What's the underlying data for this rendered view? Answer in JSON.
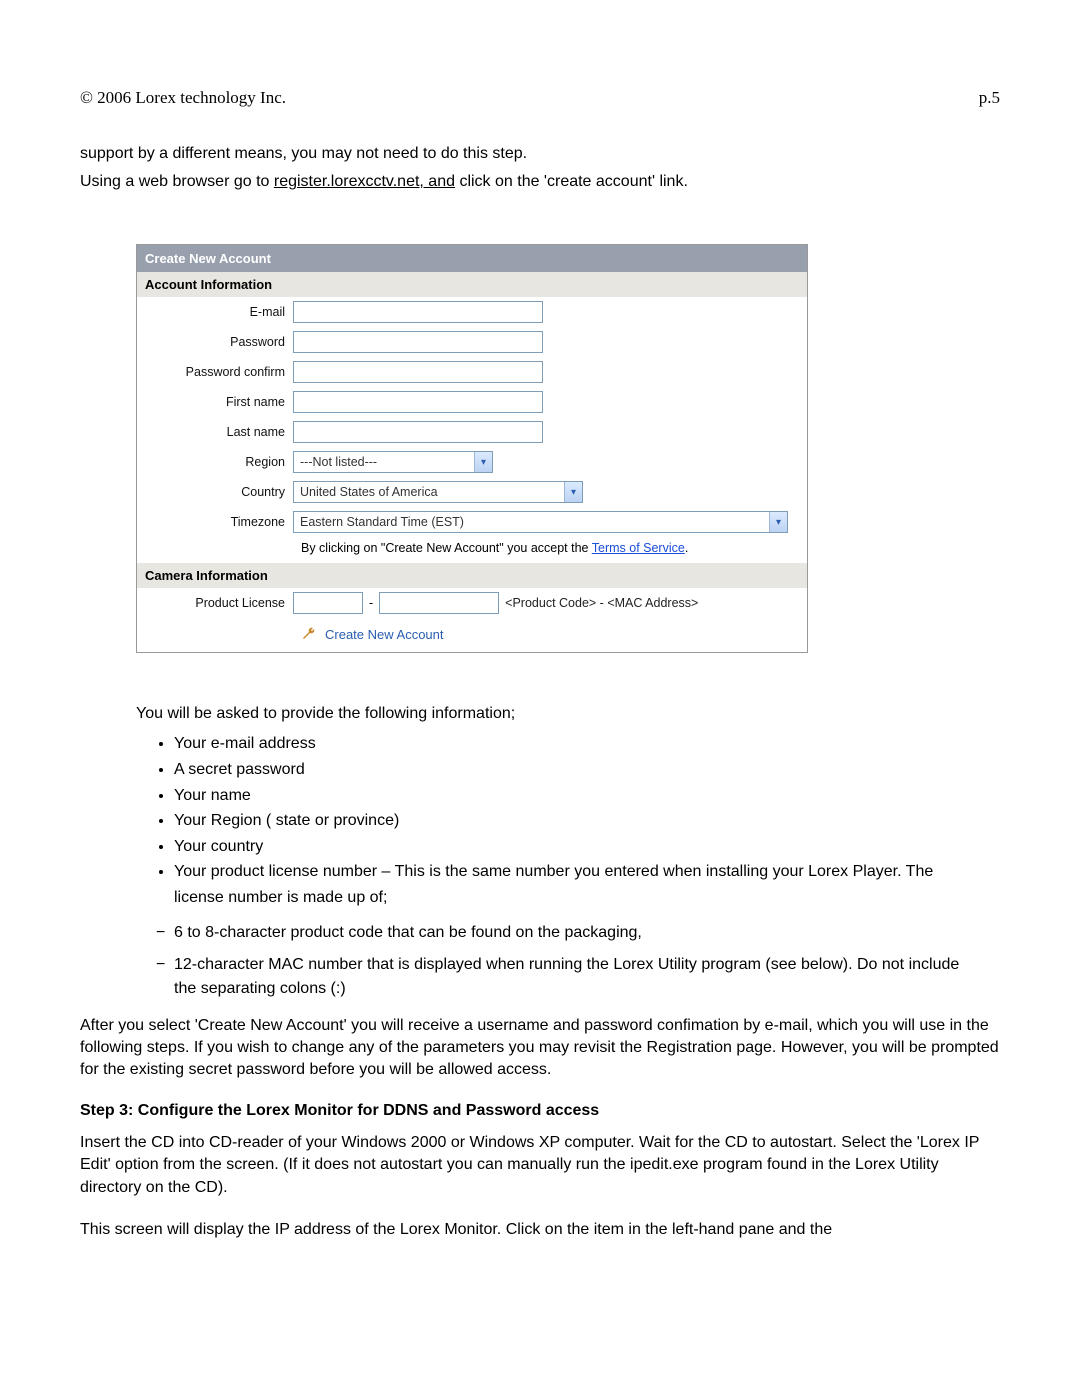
{
  "header": {
    "copyright": "© 2006 Lorex technology Inc.",
    "page": "p.5"
  },
  "intro": {
    "line1": "support by a different means, you may not need to do this step.",
    "line2a": "Using a web browser go to ",
    "link": "register.lorexcctv.net, and",
    "line2b": " click on the 'create account' link."
  },
  "form": {
    "title": "Create New Account",
    "section_account": "Account Information",
    "labels": {
      "email": "E-mail",
      "password": "Password",
      "password_confirm": "Password confirm",
      "first_name": "First name",
      "last_name": "Last name",
      "region": "Region",
      "country": "Country",
      "timezone": "Timezone",
      "product_license": "Product License"
    },
    "region_value": "---Not listed---",
    "country_value": "United States of America",
    "timezone_value": "Eastern Standard Time (EST)",
    "tos_pre": "By clicking on \"Create New Account\" you accept the ",
    "tos_link": "Terms of Service",
    "tos_post": ".",
    "section_camera": "Camera Information",
    "license_dash": "-",
    "license_hint": "<Product Code> - <MAC Address>",
    "create_label": "Create New Account"
  },
  "bodytext": {
    "provide_intro": "You will be asked to provide the following information;",
    "bullets": [
      "Your e-mail address",
      "A secret password",
      "Your name",
      "Your Region ( state or province)",
      "Your  country",
      "Your product license number – This is the same number you entered when installing your Lorex Player. The license number is made up of;"
    ],
    "dashes": [
      "6 to 8-character product code that can be found on the packaging,",
      "12-character MAC number that is displayed when running the Lorex Utility program (see below). Do not include the separating colons (:)"
    ],
    "after_para": "After you select 'Create New Account' you will receive a username and password confimation by e-mail, which you will use in the following steps.  If you wish to change any of the parameters you may revisit the Registration page.  However, you will be prompted for the existing secret password before you will be allowed access.",
    "step3_head": "Step 3: Configure the Lorex Monitor for DDNS and Password access",
    "step3_p1": "Insert the CD into CD-reader of your Windows 2000 or Windows XP computer. Wait for the CD to autostart. Select the 'Lorex IP Edit' option from the screen. (If it does not autostart you can manually run the ipedit.exe program found in the Lorex Utility directory on the CD).",
    "step3_p2": "This screen will display the IP address of the Lorex Monitor. Click on the item in the left-hand pane and the"
  }
}
